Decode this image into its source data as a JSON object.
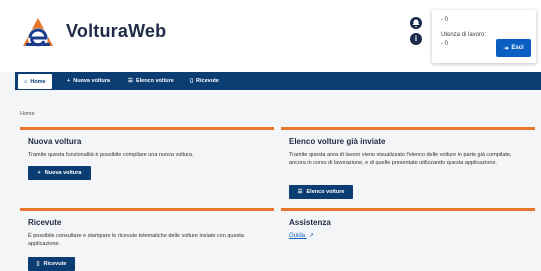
{
  "header": {
    "brand": "VolturaWeb",
    "logo_icon": "agenzia-entrate-logo",
    "bell_icon": "notification-icon",
    "info_icon": "info-icon",
    "user": {
      "line1": "- 0",
      "line2": "Utenza di lavoro:",
      "line3": "- 0",
      "exit_label": "Esci"
    }
  },
  "nav": {
    "items": [
      {
        "label": "Home",
        "icon": "home-icon"
      },
      {
        "label": "Nuova voltura",
        "icon": "plus-icon"
      },
      {
        "label": "Elenco volture",
        "icon": "list-icon"
      },
      {
        "label": "Ricevute",
        "icon": "document-icon"
      }
    ]
  },
  "breadcrumb": "Home",
  "cards": [
    {
      "title": "Nuova voltura",
      "text": "Tramite questa funzionalità è possibile compilare una nuova voltura.",
      "button": "Nuova voltura"
    },
    {
      "title": "Elenco volture già inviate",
      "text": "Tramite questa area di lavoro viene visualizzato l'elenco delle volture in parte già compilate, ancora in corso di lavorazione, e di quelle presentate utilizzando questa applicazione.",
      "button": "Elenco volture"
    },
    {
      "title": "Ricevute",
      "text": "È possibile consultare e stampare le ricevute telematiche delle volture inviate con questa applicazione.",
      "button": "Ricevute"
    },
    {
      "title": "Assistenza",
      "link": "Guida"
    }
  ],
  "colors": {
    "accent": "#e8752a",
    "nav": "#0b3d72",
    "button": "#0b5fc2"
  }
}
